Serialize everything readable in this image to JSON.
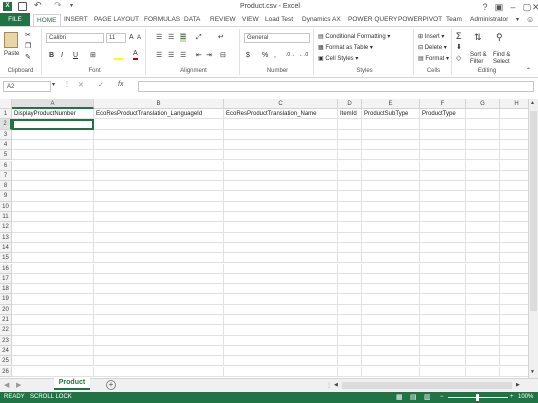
{
  "window": {
    "title": "Product.csv - Excel",
    "help": "?",
    "minimize": "–",
    "restore": "▢",
    "close": "✕"
  },
  "qat": {
    "save_icon": "save-icon",
    "undo_icon": "undo-icon",
    "redo_icon": "redo-icon"
  },
  "tabs": [
    {
      "label": "FILE"
    },
    {
      "label": "HOME"
    },
    {
      "label": "INSERT"
    },
    {
      "label": "PAGE LAYOUT"
    },
    {
      "label": "FORMULAS"
    },
    {
      "label": "DATA"
    },
    {
      "label": "REVIEW"
    },
    {
      "label": "VIEW"
    },
    {
      "label": "Load Test"
    },
    {
      "label": "Dynamics AX"
    },
    {
      "label": "POWER QUERY"
    },
    {
      "label": "POWERPIVOT"
    },
    {
      "label": "Team"
    }
  ],
  "user": "Administrator",
  "ribbon": {
    "clipboard": {
      "label": "Clipboard",
      "paste": "Paste"
    },
    "font": {
      "label": "Font",
      "name": "Calibri",
      "size": "11",
      "bold": "B",
      "italic": "I",
      "underline": "U"
    },
    "alignment": {
      "label": "Alignment"
    },
    "number": {
      "label": "Number",
      "format": "General",
      "currency": "$",
      "percent": "%"
    },
    "styles": {
      "label": "Styles",
      "conditional": "Conditional Formatting",
      "format_table": "Format as Table",
      "cell_styles": "Cell Styles"
    },
    "cells": {
      "label": "Cells",
      "insert": "Insert",
      "delete": "Delete",
      "format": "Format"
    },
    "editing": {
      "label": "Editing",
      "sort": "Sort &",
      "filter": "Filter",
      "find": "Find &",
      "select": "Select"
    }
  },
  "formula_bar": {
    "name_box": "A2",
    "fx": "fx",
    "value": ""
  },
  "columns": [
    "A",
    "B",
    "C",
    "D",
    "E",
    "F",
    "G",
    "H"
  ],
  "rows": [
    "1",
    "2",
    "3",
    "4",
    "5",
    "6",
    "7",
    "8",
    "9",
    "10",
    "11",
    "12",
    "13",
    "14",
    "15",
    "16",
    "17",
    "18",
    "19",
    "20",
    "21",
    "22",
    "23",
    "24",
    "25",
    "26"
  ],
  "headers_row": [
    "DisplayProductNumber",
    "EcoResProductTranslation_LanguageId",
    "EcoResProductTranslation_Name",
    "ItemId",
    "ProductSubType",
    "ProductType",
    "",
    ""
  ],
  "sheets": [
    {
      "name": "Product"
    }
  ],
  "status": {
    "left1": "READY",
    "left2": "SCROLL LOCK",
    "zoom": "100%"
  },
  "colors": {
    "accent": "#217346"
  }
}
